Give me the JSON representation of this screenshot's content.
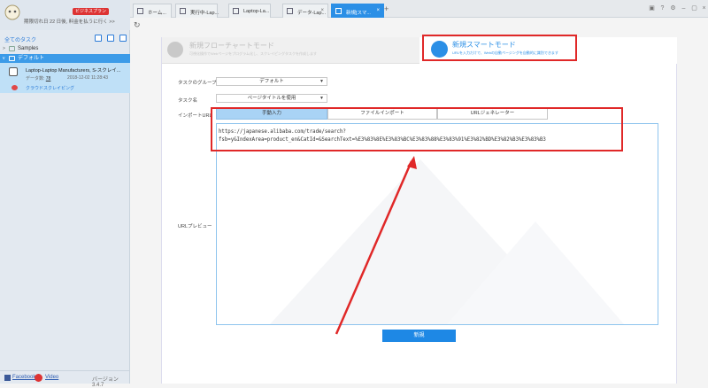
{
  "sidebar": {
    "plan_badge": "ビジネスプラン",
    "expire_text": "期限切れ日 22 日後, 料金を払うに行く >>",
    "toolbar_title": "全てのタスク",
    "tree": {
      "samples": "Samples",
      "default": "デフォルト"
    },
    "task": {
      "name": "Laptop-Laptop Manufacturers, S-スクレイ...",
      "count_label": "データ数:",
      "count_value": "78",
      "date": "2018-12-02 11:28:43",
      "cloud": "クラウドスクレイピング"
    },
    "footer": {
      "facebook": "Facebook",
      "video": "Video",
      "version": "バージョン 3.4.7"
    }
  },
  "tabs": [
    {
      "label": "ホーム...",
      "active": false
    },
    {
      "label": "実行中-Lap...",
      "active": false
    },
    {
      "label": "Laptop-La...",
      "active": false
    },
    {
      "label": "データ-Lap...",
      "active": false
    },
    {
      "label": "新規[スマ...",
      "active": true
    }
  ],
  "tab_add": "+",
  "modes": {
    "flowchart": {
      "title": "新規フローチャートモード",
      "desc": "可視化操作でWebページをプログラム化し、スクレイピングタスクを作成します"
    },
    "smart": {
      "title": "新規スマートモード",
      "desc": "URLを入力だけで、Webの自動ページングを自動的に識別できます"
    }
  },
  "form": {
    "group_label": "タスクのグループ",
    "group_value": "デフォルト",
    "name_label": "タスク名",
    "name_value": "ページタイトルを使用",
    "import_label": "インポートURL",
    "import_tabs": [
      "手動入力",
      "ファイルインポート",
      "URLジェネレーター"
    ],
    "url_line1": "https://japanese.alibaba.com/trade/search?",
    "url_line2": "fsb=y&IndexArea=product_en&CatId=&SearchText=%E3%83%8E%E3%83%BC%E3%83%88%E3%83%91%E3%82%BD%E3%82%B3%E3%83%B3",
    "preview_label": "URLプレビュー",
    "submit": "新規"
  },
  "colors": {
    "accent": "#2b8fe6",
    "highlight": "#e02828",
    "selected_row": "#3c9be8"
  }
}
